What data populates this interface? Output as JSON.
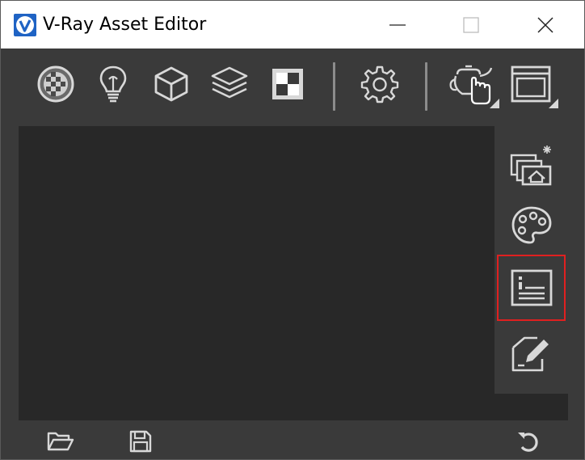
{
  "window": {
    "title": "V-Ray Asset Editor",
    "controls": [
      "minimize",
      "maximize",
      "close"
    ]
  },
  "toolbar": {
    "buttons": [
      {
        "id": "materials",
        "icon": "materials-sphere-icon"
      },
      {
        "id": "lights",
        "icon": "lightbulb-icon"
      },
      {
        "id": "geometry",
        "icon": "cube-icon"
      },
      {
        "id": "render-elements",
        "icon": "layers-icon"
      },
      {
        "id": "textures",
        "icon": "texture-icon"
      },
      {
        "id": "settings",
        "icon": "gear-icon"
      },
      {
        "id": "render-interactive",
        "icon": "teapot-hand-icon"
      },
      {
        "id": "frame-buffer",
        "icon": "frame-buffer-icon"
      }
    ]
  },
  "side_panel": {
    "buttons": [
      {
        "id": "render-view",
        "icon": "render-scene-icon",
        "selected": false
      },
      {
        "id": "palette",
        "icon": "palette-icon",
        "selected": false
      },
      {
        "id": "info-panel",
        "icon": "info-panel-icon",
        "selected": true
      },
      {
        "id": "edit",
        "icon": "edit-pen-icon",
        "selected": false
      }
    ]
  },
  "bottom_bar": {
    "buttons": [
      {
        "id": "open",
        "icon": "folder-open-icon"
      },
      {
        "id": "save",
        "icon": "floppy-save-icon"
      },
      {
        "id": "reset",
        "icon": "undo-icon"
      }
    ]
  },
  "colors": {
    "title_bg": "#ffffff",
    "window_bg": "#3a3a3a",
    "panel_bg": "#282828",
    "icon": "#d8d8d8",
    "brand": "#1f63c4",
    "selection_border": "#e02020"
  }
}
